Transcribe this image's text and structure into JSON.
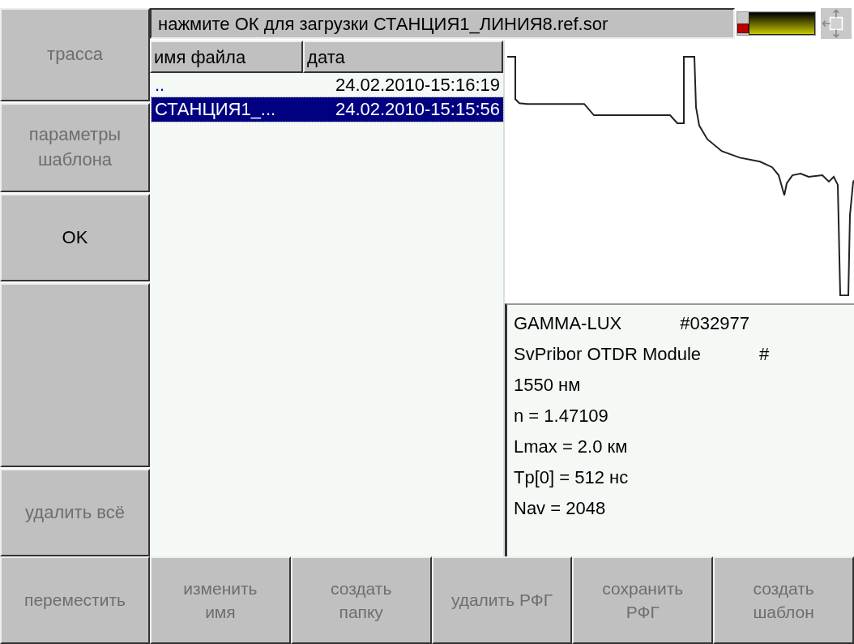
{
  "side_buttons": [
    {
      "label": "трасса",
      "disabled": true
    },
    {
      "label": "параметры шаблона",
      "disabled": true
    },
    {
      "label": "OK",
      "disabled": false
    },
    {
      "label": "удалить всё",
      "disabled": true
    }
  ],
  "status": "нажмите ОК для загрузки СТАНЦИЯ1_ЛИНИЯ8.ref.sor",
  "file_list": {
    "columns": [
      "имя файла",
      "дата"
    ],
    "rows": [
      {
        "name": "..",
        "date": "24.02.2010-15:16:19",
        "selected": false
      },
      {
        "name": "СТАНЦИЯ1_...",
        "date": "24.02.2010-15:15:56",
        "selected": true
      }
    ]
  },
  "info": [
    {
      "text": "GAMMA-LUX",
      "extra": "#032977"
    },
    {
      "text": "SvPribor OTDR Module",
      "extra": "#"
    },
    {
      "text": "1550 нм"
    },
    {
      "text": "n = 1.47109"
    },
    {
      "text": "Lmax = 2.0 км"
    },
    {
      "text": "Tp[0] = 512 нс"
    },
    {
      "text": "Nav = 2048"
    }
  ],
  "bottom_buttons": [
    {
      "label": "переместить",
      "disabled": true
    },
    {
      "label": "изменить имя",
      "disabled": true
    },
    {
      "label": "создать папку",
      "disabled": true
    },
    {
      "label": "удалить РФГ",
      "disabled": true
    },
    {
      "label": "сохранить РФГ",
      "disabled": true
    },
    {
      "label": "создать шаблон",
      "disabled": true
    }
  ]
}
